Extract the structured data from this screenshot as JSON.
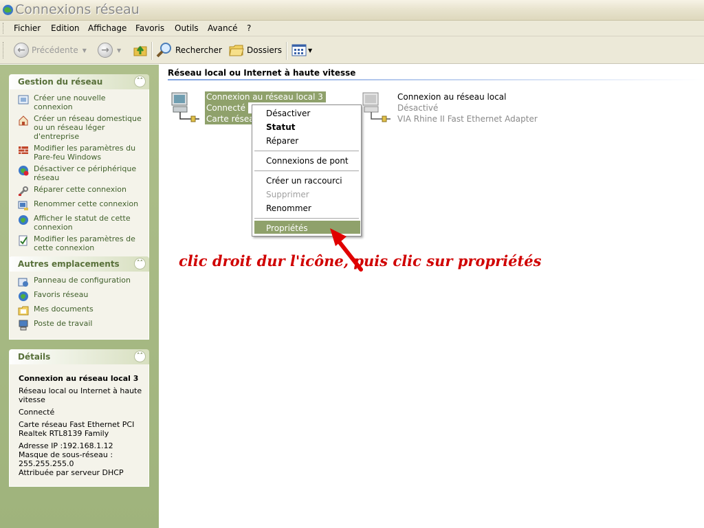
{
  "window": {
    "title": "Connexions réseau"
  },
  "menubar": [
    "Fichier",
    "Edition",
    "Affichage",
    "Favoris",
    "Outils",
    "Avancé",
    "?"
  ],
  "toolbar": {
    "back_label": "Précédente",
    "search_label": "Rechercher",
    "folders_label": "Dossiers"
  },
  "sidebar": {
    "network_tasks": {
      "title": "Gestion du réseau",
      "items": [
        {
          "label": "Créer une nouvelle connexion",
          "icon": "new-connection-icon"
        },
        {
          "label": "Créer un réseau domestique ou un réseau léger d'entreprise",
          "icon": "home-network-icon"
        },
        {
          "label": "Modifier les paramètres du Pare-feu Windows",
          "icon": "firewall-icon"
        },
        {
          "label": "Désactiver ce périphérique réseau",
          "icon": "disable-network-icon"
        },
        {
          "label": "Réparer cette connexion",
          "icon": "repair-icon"
        },
        {
          "label": "Renommer cette connexion",
          "icon": "rename-icon"
        },
        {
          "label": "Afficher le statut de cette connexion",
          "icon": "status-icon"
        },
        {
          "label": "Modifier les paramètres de cette connexion",
          "icon": "settings-icon"
        }
      ]
    },
    "other_places": {
      "title": "Autres emplacements",
      "items": [
        {
          "label": "Panneau de configuration",
          "icon": "control-panel-icon"
        },
        {
          "label": "Favoris réseau",
          "icon": "network-places-icon"
        },
        {
          "label": "Mes documents",
          "icon": "my-documents-icon"
        },
        {
          "label": "Poste de travail",
          "icon": "my-computer-icon"
        }
      ]
    },
    "details": {
      "title": "Détails",
      "name": "Connexion au réseau local 3",
      "type": "Réseau local ou Internet à haute vitesse",
      "status": "Connecté",
      "adapter": "Carte réseau Fast Ethernet PCI Realtek RTL8139 Family",
      "ip": "Adresse IP :192.168.1.12",
      "mask_label": "Masque de sous-réseau :",
      "mask_value": "255.255.255.0",
      "assigned": "Attribuée par serveur DHCP"
    }
  },
  "content": {
    "category_header": "Réseau local ou Internet à haute vitesse",
    "connections": [
      {
        "name": "Connexion au réseau local 3",
        "status": "Connecté",
        "device": "Carte résea"
      },
      {
        "name": "Connexion au réseau local",
        "status": "Désactivé",
        "device": "VIA Rhine II Fast Ethernet Adapter"
      }
    ]
  },
  "context_menu": {
    "items": [
      "Désactiver",
      "Statut",
      "Réparer",
      "Connexions de pont",
      "Créer un raccourci",
      "Supprimer",
      "Renommer",
      "Propriétés"
    ]
  },
  "annotation": "clic droit dur l'icône, puis clic sur propriétés",
  "colors": {
    "selection": "#8fa16b",
    "panel_bg": "#a5b782",
    "task_link": "#3f5f2a",
    "annotation": "#d00000"
  }
}
